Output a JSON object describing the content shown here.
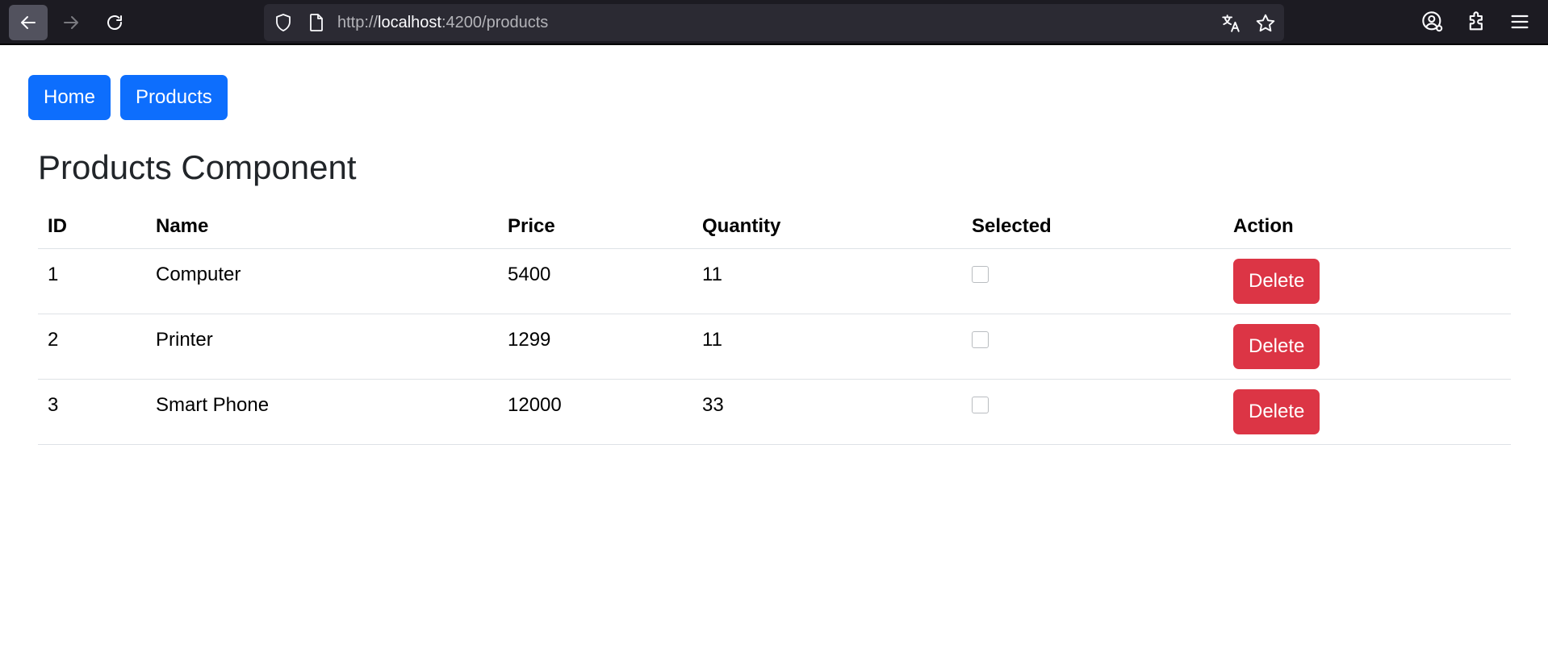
{
  "browser": {
    "url_scheme": "http://",
    "url_host": "localhost",
    "url_rest": ":4200/products",
    "icons": [
      "back-arrow-icon",
      "forward-arrow-icon",
      "reload-icon",
      "shield-icon",
      "page-icon",
      "translate-icon",
      "star-icon",
      "account-icon",
      "extensions-icon",
      "menu-icon"
    ]
  },
  "nav": {
    "home_label": "Home",
    "products_label": "Products"
  },
  "page": {
    "title": "Products Component"
  },
  "table": {
    "headers": [
      "ID",
      "Name",
      "Price",
      "Quantity",
      "Selected",
      "Action"
    ],
    "rows": [
      {
        "id": "1",
        "name": "Computer",
        "price": "5400",
        "quantity": "11",
        "selected": false,
        "action": "Delete"
      },
      {
        "id": "2",
        "name": "Printer",
        "price": "1299",
        "quantity": "11",
        "selected": false,
        "action": "Delete"
      },
      {
        "id": "3",
        "name": "Smart Phone",
        "price": "12000",
        "quantity": "33",
        "selected": false,
        "action": "Delete"
      }
    ]
  },
  "colors": {
    "primary": "#0d6efd",
    "danger": "#dc3545",
    "chrome_bg": "#1c1b22",
    "urlbar_bg": "#2b2a33"
  }
}
